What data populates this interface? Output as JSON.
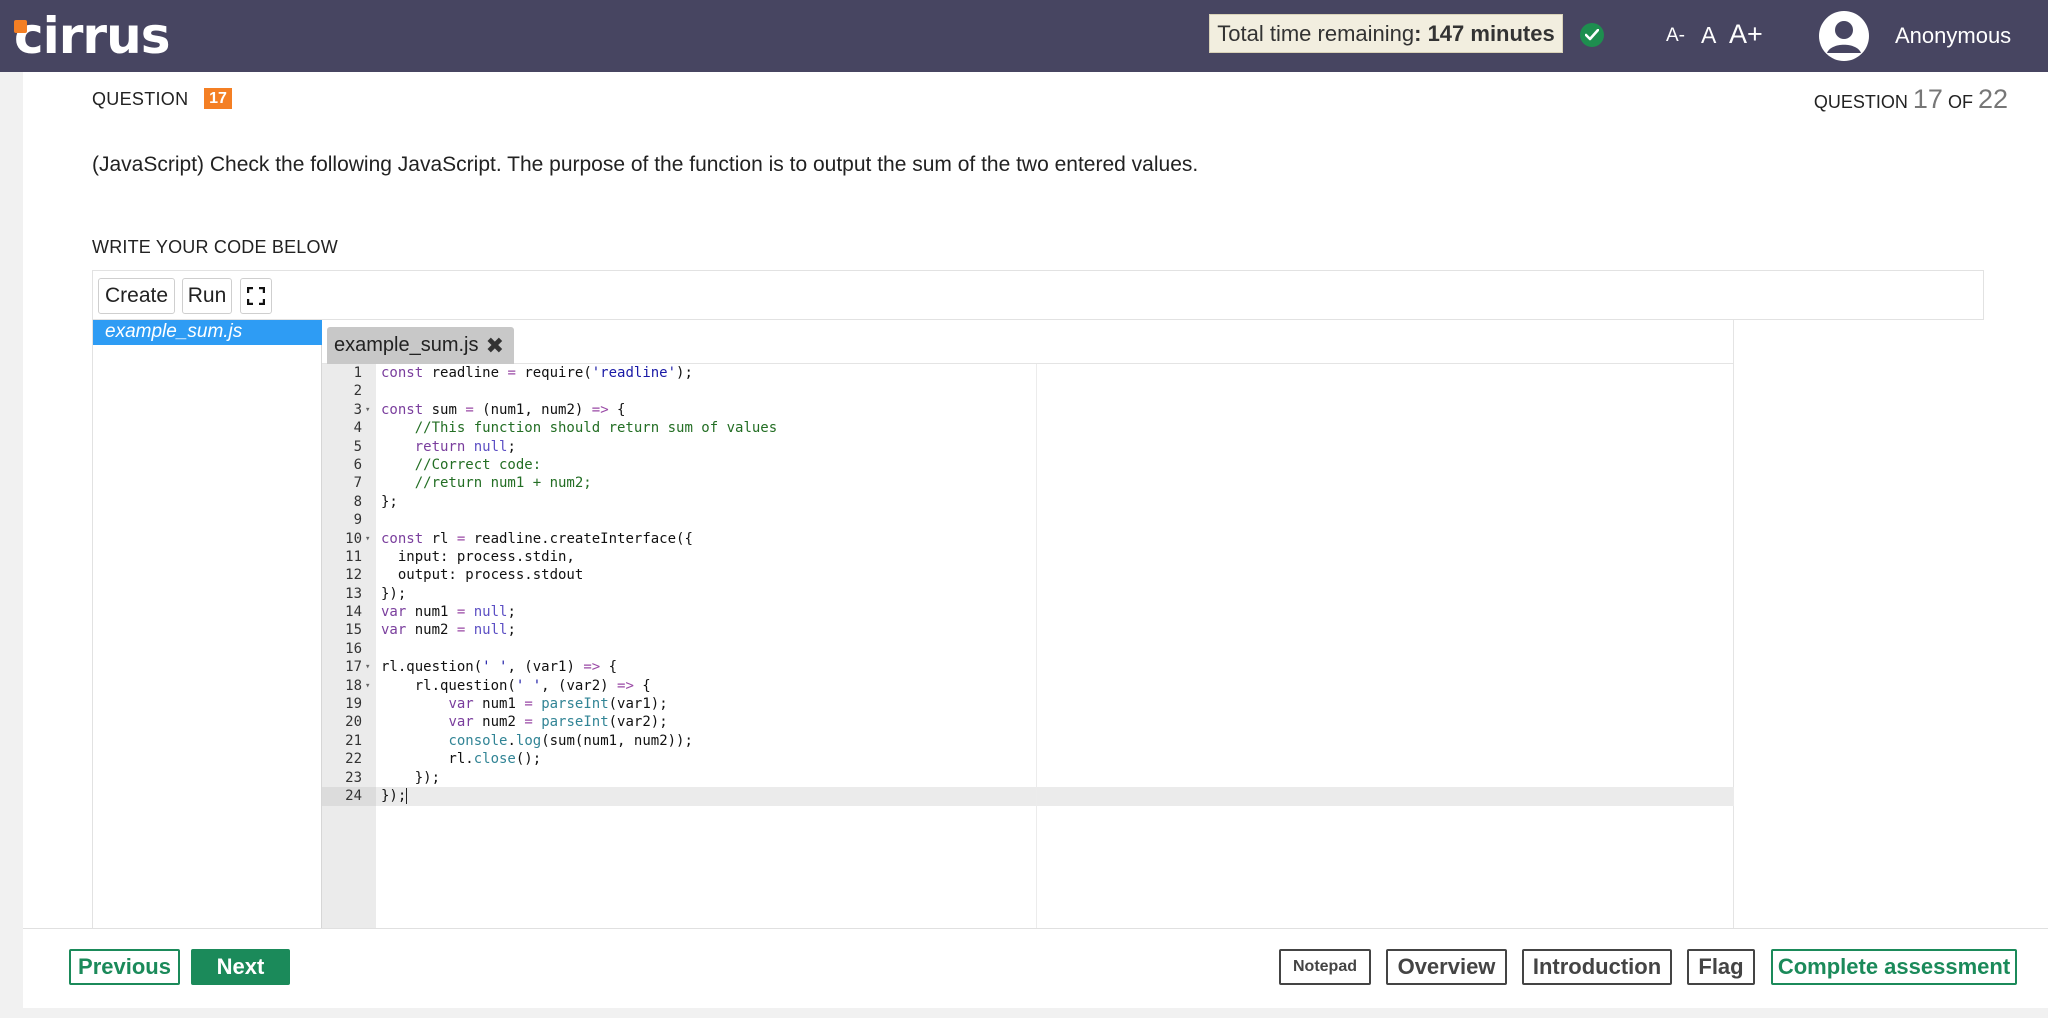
{
  "header": {
    "logo_text": "cirrus",
    "timer_label": "Total time remaining",
    "timer_value": ": 147 minutes",
    "status_icon": "check-circle-icon",
    "font_smaller": "A-",
    "font_normal": "A",
    "font_larger": "A+",
    "user_name": "Anonymous",
    "colors": {
      "bar": "#474561",
      "logo_accent": "#f47f24",
      "check": "#1e8e4f"
    }
  },
  "question": {
    "label": "QUESTION",
    "badge": "17",
    "progress_prefix": "QUESTION",
    "progress_current": "17",
    "progress_of": "OF",
    "progress_total": "22",
    "text": "(JavaScript) Check the following JavaScript. The purpose of the function is to output the sum of the two entered values.",
    "write_label": "WRITE YOUR CODE BELOW"
  },
  "editor": {
    "toolbar": {
      "create": "Create",
      "run": "Run",
      "fullscreen_icon": "fullscreen-icon"
    },
    "files": [
      "example_sum.js"
    ],
    "active_tab": "example_sum.js",
    "close_glyph": "✖",
    "colors": {
      "file_selected": "#2e9cf4",
      "keyword": "#1a1aa6",
      "string": "#1a1aa6",
      "comment": "#236e24",
      "builtin": "#318495",
      "operator": "#687687"
    },
    "lines": [
      "const readline = require('readline');",
      "",
      "const sum = (num1, num2) => {",
      "    //This function should return sum of values",
      "    return null;",
      "    //Correct code:",
      "    //return num1 + num2;",
      "};",
      "",
      "const rl = readline.createInterface({",
      "  input: process.stdin,",
      "  output: process.stdout",
      "});",
      "var num1 = null;",
      "var num2 = null;",
      "",
      "rl.question(' ', (var1) => {",
      "    rl.question(' ', (var2) => {",
      "        var num1 = parseInt(var1);",
      "        var num2 = parseInt(var2);",
      "        console.log(sum(num1, num2));",
      "        rl.close();",
      "    });",
      "});"
    ],
    "fold_lines": [
      3,
      10,
      17,
      18
    ],
    "active_line": 24
  },
  "footer": {
    "previous": "Previous",
    "next": "Next",
    "notepad": "Notepad",
    "overview": "Overview",
    "introduction": "Introduction",
    "flag": "Flag",
    "complete": "Complete assessment",
    "accent": "#1b8a5a"
  }
}
